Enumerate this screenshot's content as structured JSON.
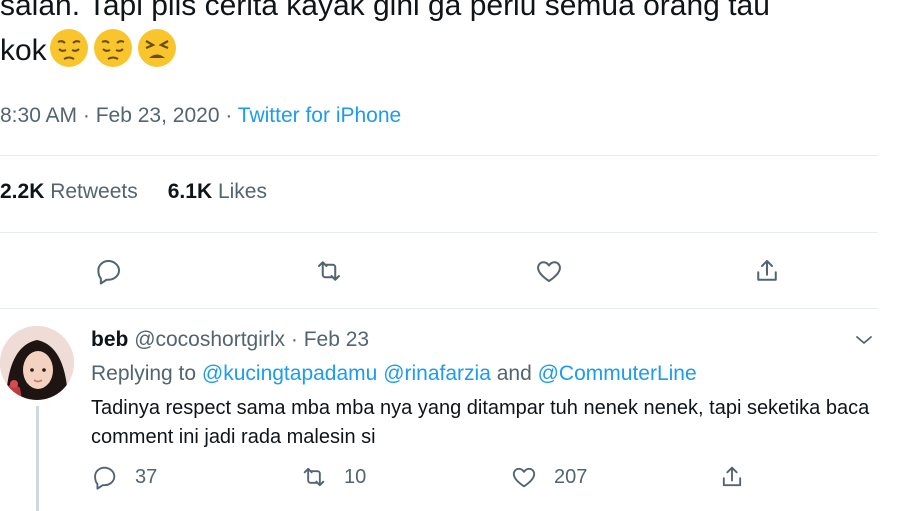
{
  "tweet": {
    "text_line1": "salah. Tapi plis cerita kayak gini ga perlu semua orang tau",
    "text_line2": "kok",
    "emojis": [
      "pensive-face",
      "pensive-face",
      "persevering-face"
    ],
    "time": "8:30 AM",
    "sep1": " · ",
    "date": "Feb 23, 2020",
    "sep2": " · ",
    "source": "Twitter for iPhone",
    "retweets_count": "2.2K",
    "retweets_label": "Retweets",
    "likes_count": "6.1K",
    "likes_label": "Likes"
  },
  "actions": {
    "icons": [
      "reply-icon",
      "retweet-icon",
      "like-icon",
      "share-icon"
    ]
  },
  "reply": {
    "name": "beb",
    "handle": "@cocoshortgirlx",
    "sep": " · ",
    "date": "Feb 23",
    "replying_to_label": "Replying to",
    "mention1": "@kucingtapadamu",
    "mention2": "@rinafarzia",
    "and": "and",
    "mention3": "@CommuterLine",
    "text": "Tadinya respect sama mba mba nya yang ditampar tuh nenek nenek, tapi seketika baca comment ini jadi rada malesin si",
    "reply_count": "37",
    "retweet_count": "10",
    "like_count": "207"
  },
  "colors": {
    "link": "#1d9bf0",
    "muted": "#536471",
    "text": "#0f1419",
    "divider": "#e6ecf0"
  }
}
